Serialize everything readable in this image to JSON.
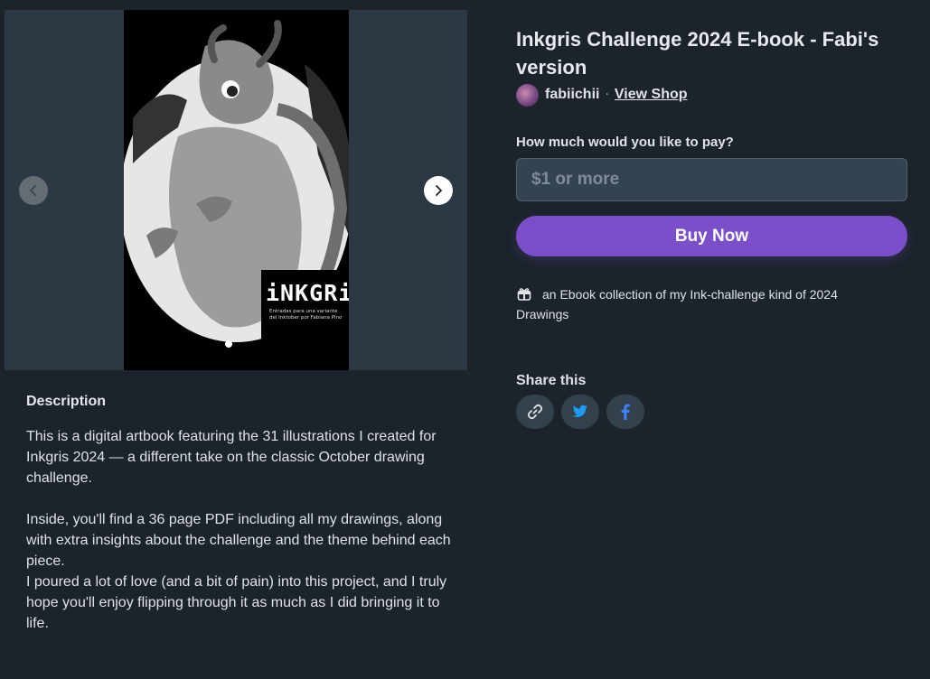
{
  "product": {
    "title": "Inkgris Challenge 2024 E-book - Fabi's version",
    "seller_name": "fabiichii",
    "separator": "·",
    "view_shop_label": "View Shop"
  },
  "gallery": {
    "cover_title": "iNKGRiS",
    "cover_subtitle": "Entradas para una variante del Inktober por Fabiana Pino",
    "current_slide": 1,
    "total_slides": 1
  },
  "purchase": {
    "pay_label": "How much would you like to pay?",
    "pay_placeholder": "$1 or more",
    "buy_label": "Buy Now",
    "includes_text": "an Ebook collection of my Ink-challenge kind of 2024 Drawings"
  },
  "share": {
    "label": "Share this",
    "buttons": [
      "link-icon",
      "twitter-icon",
      "facebook-icon"
    ]
  },
  "description": {
    "heading": "Description",
    "paragraph1": "This is a digital artbook featuring the 31 illustrations I created for Inkgris 2024 — a different take on the classic October drawing challenge.",
    "paragraph2": "Inside, you'll find a 36 page PDF including all my drawings, along with extra insights about the challenge and the theme behind each piece.",
    "paragraph3": "I poured a lot of love (and a bit of pain) into this project, and I truly hope you'll enjoy flipping through it as much as I did bringing it to life."
  },
  "colors": {
    "background": "#1c232b",
    "accent": "#7b4fc9",
    "input_bg": "#344350",
    "share_bg": "#33414d"
  }
}
